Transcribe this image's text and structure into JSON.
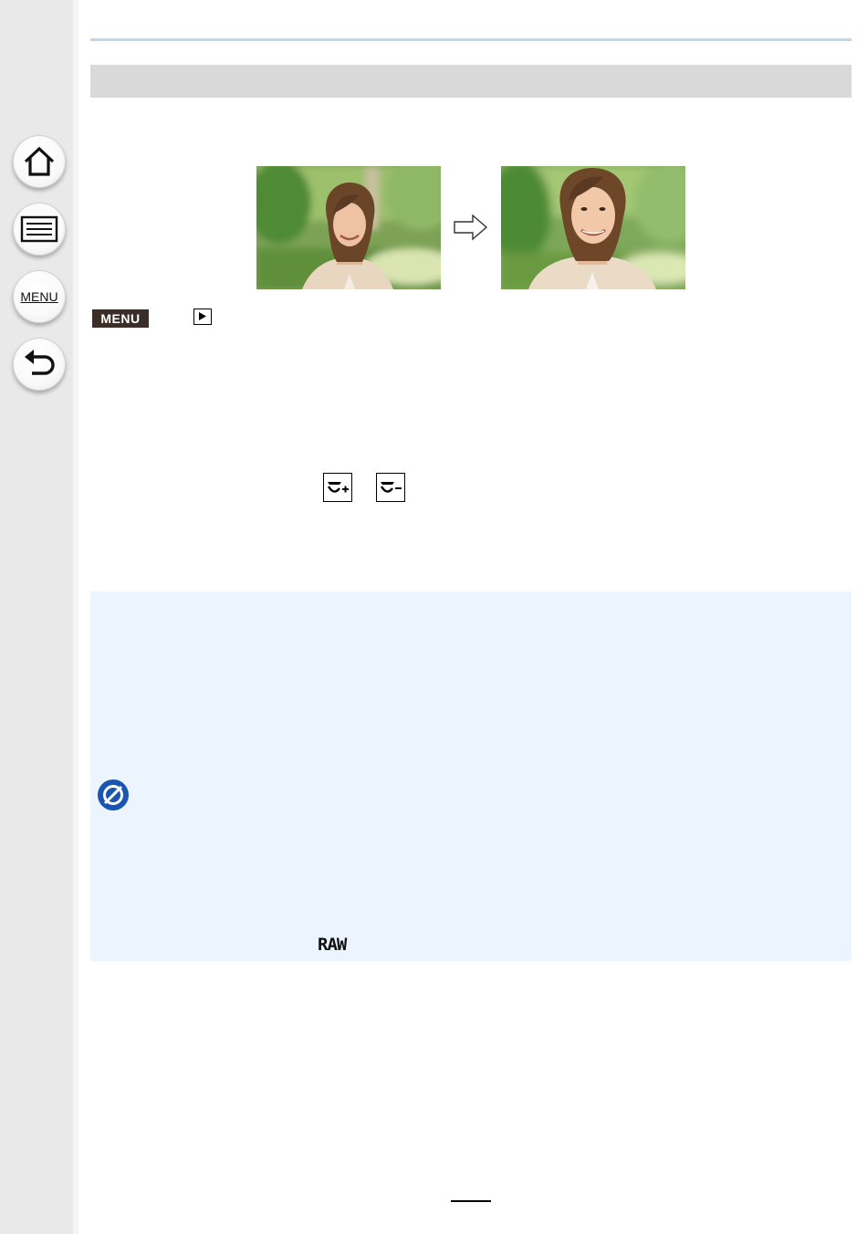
{
  "nav": {
    "menu_label": "MENU",
    "items": [
      {
        "name": "home",
        "icon": "home-icon"
      },
      {
        "name": "contents",
        "icon": "list-icon"
      },
      {
        "name": "menu",
        "icon": "menu-text-icon"
      },
      {
        "name": "back",
        "icon": "back-arrow-icon"
      }
    ]
  },
  "procedure": {
    "menu_badge": "MENU",
    "playback_icon": "playback-icon"
  },
  "beauty_icons": [
    "beauty-retouch-plus-icon",
    "beauty-retouch-minus-icon"
  ],
  "notes": {
    "not_available_icon": "not-available-icon",
    "raw_label": "RAW"
  },
  "colors": {
    "sidebar": "#e9e9e9",
    "title_bar": "#d9d9d9",
    "note_box": "#ecf4fd",
    "menu_badge": "#3b2e28",
    "no_icon": "#1a56b0",
    "top_line": "#c5d5e6"
  }
}
